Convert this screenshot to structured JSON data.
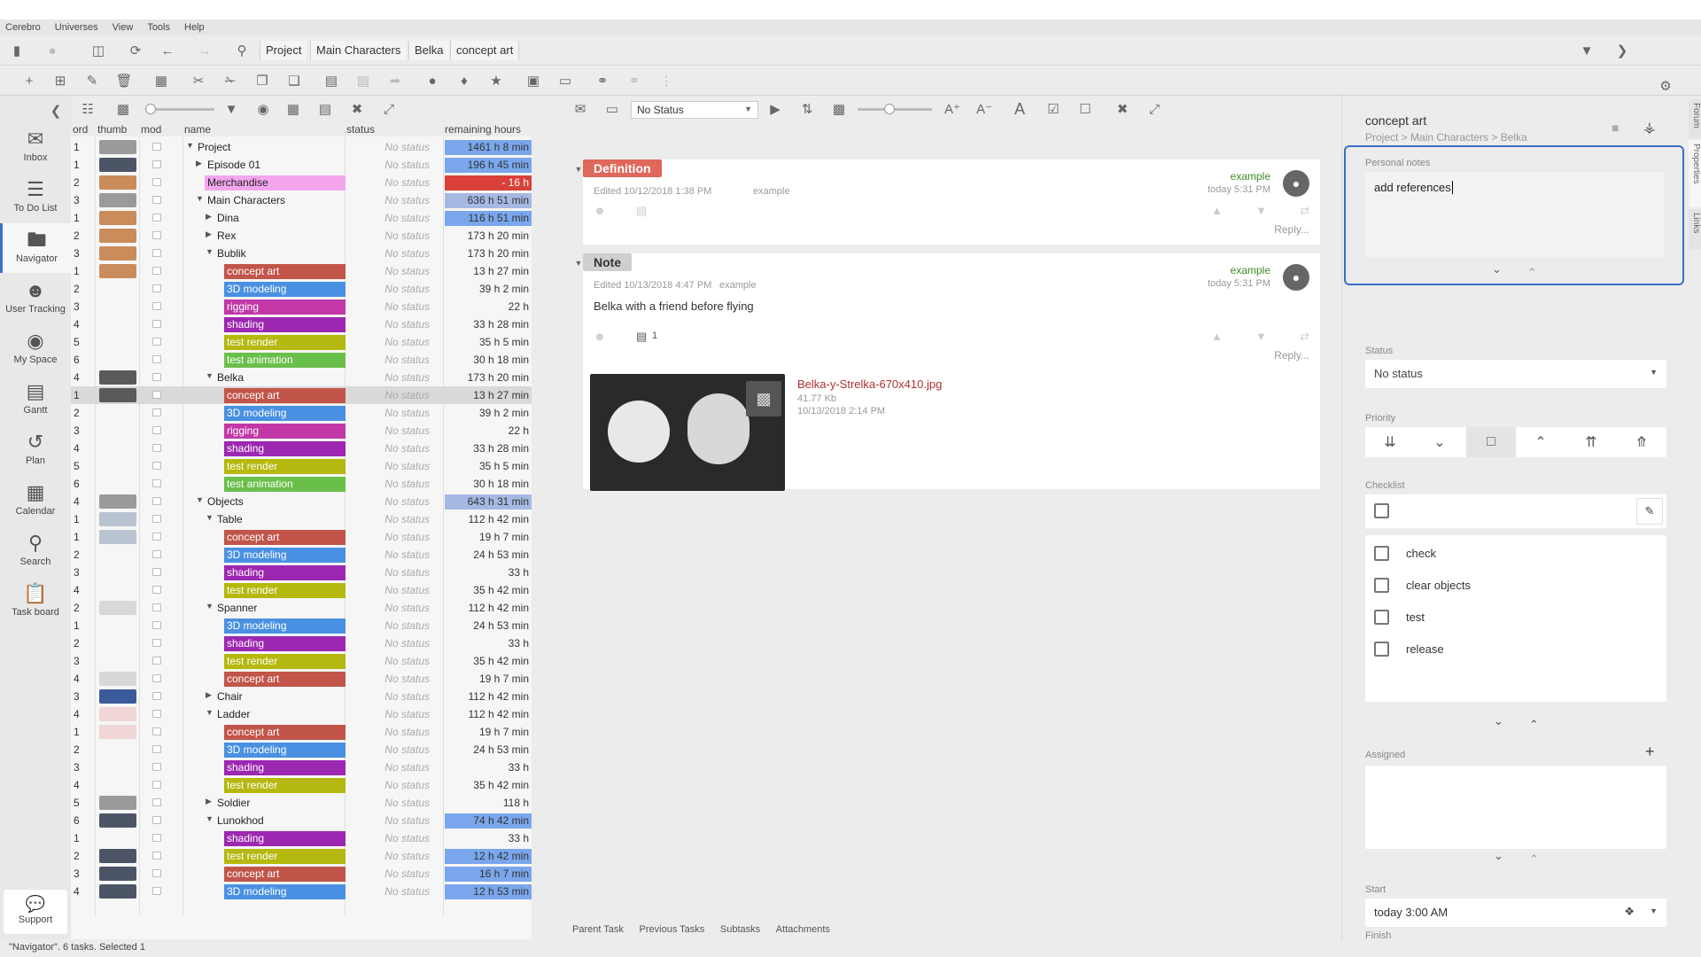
{
  "menu": [
    "Cerebro",
    "Universes",
    "View",
    "Tools",
    "Help"
  ],
  "breadcrumb": [
    "Project",
    "Main Characters",
    "Belka",
    "concept art"
  ],
  "sidebar": [
    {
      "label": "Inbox",
      "icon": "inbox-icon"
    },
    {
      "label": "To Do List",
      "icon": "list-icon"
    },
    {
      "label": "Navigator",
      "icon": "folder-icon"
    },
    {
      "label": "User Tracking",
      "icon": "users-icon"
    },
    {
      "label": "My Space",
      "icon": "globe-icon"
    },
    {
      "label": "Gantt",
      "icon": "gantt-icon"
    },
    {
      "label": "Plan",
      "icon": "plan-icon"
    },
    {
      "label": "Calendar",
      "icon": "calendar-icon"
    },
    {
      "label": "Search",
      "icon": "search-icon"
    },
    {
      "label": "Task board",
      "icon": "clipboard-icon"
    }
  ],
  "support_label": "Support",
  "columns": {
    "ord": "ord",
    "thumb": "thumb",
    "mod": "mod",
    "name": "name",
    "status": "status",
    "remaining": "remaining hours"
  },
  "status_default": "No status",
  "rows": [
    {
      "ord": "1",
      "name": "Project",
      "depth": 0,
      "tw": "open",
      "remaining": "1461 h 8 min",
      "rem_color": "#7aa7ec",
      "thumb": "gray"
    },
    {
      "ord": "1",
      "name": "Episode 01",
      "depth": 1,
      "tw": "closed",
      "remaining": "196 h 45 min",
      "rem_color": "#7aa7ec",
      "thumb": "dark"
    },
    {
      "ord": "2",
      "name": "Merchandise",
      "depth": 1,
      "tw": "none",
      "name_color": "#f3a6ee",
      "remaining": "- 16 h",
      "rem_color": "#d9403a",
      "thumb": "dog"
    },
    {
      "ord": "3",
      "name": "Main Characters",
      "depth": 1,
      "tw": "open",
      "remaining": "636 h 51 min",
      "rem_color": "#a5b9e3",
      "thumb": "gray"
    },
    {
      "ord": "1",
      "name": "Dina",
      "depth": 2,
      "tw": "closed",
      "remaining": "116 h 51 min",
      "rem_color": "#7aa7ec",
      "thumb": "dog"
    },
    {
      "ord": "2",
      "name": "Rex",
      "depth": 2,
      "tw": "closed",
      "remaining": "173 h 20 min",
      "thumb": "dog"
    },
    {
      "ord": "3",
      "name": "Bublik",
      "depth": 2,
      "tw": "open",
      "remaining": "173 h 20 min",
      "thumb": "dog"
    },
    {
      "ord": "1",
      "name": "concept art",
      "depth": 3,
      "tw": "none",
      "name_color": "#c2554a",
      "remaining": "13 h 27 min",
      "thumb": "dog"
    },
    {
      "ord": "2",
      "name": "3D modeling",
      "depth": 3,
      "tw": "none",
      "name_color": "#4a90e2",
      "remaining": "39 h 2 min"
    },
    {
      "ord": "3",
      "name": "rigging",
      "depth": 3,
      "tw": "none",
      "name_color": "#c238a6",
      "remaining": "22 h"
    },
    {
      "ord": "4",
      "name": "shading",
      "depth": 3,
      "tw": "none",
      "name_color": "#9c27b0",
      "remaining": "33 h 28 min"
    },
    {
      "ord": "5",
      "name": "test render",
      "depth": 3,
      "tw": "none",
      "name_color": "#b5b80e",
      "remaining": "35 h 5 min"
    },
    {
      "ord": "6",
      "name": "test animation",
      "depth": 3,
      "tw": "none",
      "name_color": "#6abf4b",
      "remaining": "30 h 18 min"
    },
    {
      "ord": "4",
      "name": "Belka",
      "depth": 2,
      "tw": "open",
      "remaining": "173 h 20 min",
      "thumb": "bw"
    },
    {
      "ord": "1",
      "name": "concept art",
      "depth": 3,
      "tw": "none",
      "name_color": "#c2554a",
      "remaining": "13 h 27 min",
      "thumb": "bw",
      "selected": true
    },
    {
      "ord": "2",
      "name": "3D modeling",
      "depth": 3,
      "tw": "none",
      "name_color": "#4a90e2",
      "remaining": "39 h 2 min"
    },
    {
      "ord": "3",
      "name": "rigging",
      "depth": 3,
      "tw": "none",
      "name_color": "#c238a6",
      "remaining": "22 h"
    },
    {
      "ord": "4",
      "name": "shading",
      "depth": 3,
      "tw": "none",
      "name_color": "#9c27b0",
      "remaining": "33 h 28 min"
    },
    {
      "ord": "5",
      "name": "test render",
      "depth": 3,
      "tw": "none",
      "name_color": "#b5b80e",
      "remaining": "35 h 5 min"
    },
    {
      "ord": "6",
      "name": "test animation",
      "depth": 3,
      "tw": "none",
      "name_color": "#6abf4b",
      "remaining": "30 h 18 min"
    },
    {
      "ord": "4",
      "name": "Objects",
      "depth": 1,
      "tw": "open",
      "remaining": "643 h 31 min",
      "rem_color": "#a5b9e3",
      "thumb": "gray"
    },
    {
      "ord": "1",
      "name": "Table",
      "depth": 2,
      "tw": "open",
      "remaining": "112 h 42 min",
      "thumb": "sketch"
    },
    {
      "ord": "1",
      "name": "concept art",
      "depth": 3,
      "tw": "none",
      "name_color": "#c2554a",
      "remaining": "19 h 7 min",
      "thumb": "sketch"
    },
    {
      "ord": "2",
      "name": "3D modeling",
      "depth": 3,
      "tw": "none",
      "name_color": "#4a90e2",
      "remaining": "24 h 53 min"
    },
    {
      "ord": "3",
      "name": "shading",
      "depth": 3,
      "tw": "none",
      "name_color": "#9c27b0",
      "remaining": "33 h"
    },
    {
      "ord": "4",
      "name": "test render",
      "depth": 3,
      "tw": "none",
      "name_color": "#b5b80e",
      "remaining": "35 h 42 min"
    },
    {
      "ord": "2",
      "name": "Spanner",
      "depth": 2,
      "tw": "open",
      "remaining": "112 h 42 min",
      "thumb": "tool"
    },
    {
      "ord": "1",
      "name": "3D modeling",
      "depth": 3,
      "tw": "none",
      "name_color": "#4a90e2",
      "remaining": "24 h 53 min"
    },
    {
      "ord": "2",
      "name": "shading",
      "depth": 3,
      "tw": "none",
      "name_color": "#9c27b0",
      "remaining": "33 h"
    },
    {
      "ord": "3",
      "name": "test render",
      "depth": 3,
      "tw": "none",
      "name_color": "#b5b80e",
      "remaining": "35 h 42 min"
    },
    {
      "ord": "4",
      "name": "concept art",
      "depth": 3,
      "tw": "none",
      "name_color": "#c2554a",
      "remaining": "19 h 7 min",
      "thumb": "tool"
    },
    {
      "ord": "3",
      "name": "Chair",
      "depth": 2,
      "tw": "closed",
      "remaining": "112 h 42 min",
      "thumb": "blue"
    },
    {
      "ord": "4",
      "name": "Ladder",
      "depth": 2,
      "tw": "open",
      "remaining": "112 h 42 min",
      "thumb": "red"
    },
    {
      "ord": "1",
      "name": "concept art",
      "depth": 3,
      "tw": "none",
      "name_color": "#c2554a",
      "remaining": "19 h 7 min",
      "thumb": "red"
    },
    {
      "ord": "2",
      "name": "3D modeling",
      "depth": 3,
      "tw": "none",
      "name_color": "#4a90e2",
      "remaining": "24 h 53 min"
    },
    {
      "ord": "3",
      "name": "shading",
      "depth": 3,
      "tw": "none",
      "name_color": "#9c27b0",
      "remaining": "33 h"
    },
    {
      "ord": "4",
      "name": "test render",
      "depth": 3,
      "tw": "none",
      "name_color": "#b5b80e",
      "remaining": "35 h 42 min"
    },
    {
      "ord": "5",
      "name": "Soldier",
      "depth": 2,
      "tw": "closed",
      "remaining": "118 h",
      "thumb": "gray"
    },
    {
      "ord": "6",
      "name": "Lunokhod",
      "depth": 2,
      "tw": "open",
      "remaining": "74 h 42 min",
      "rem_color": "#7aa7ec",
      "thumb": "dark"
    },
    {
      "ord": "1",
      "name": "shading",
      "depth": 3,
      "tw": "none",
      "name_color": "#9c27b0",
      "remaining": "33 h"
    },
    {
      "ord": "2",
      "name": "test render",
      "depth": 3,
      "tw": "none",
      "name_color": "#b5b80e",
      "remaining": "12 h 42 min",
      "rem_color": "#7aa7ec",
      "thumb": "dark"
    },
    {
      "ord": "3",
      "name": "concept art",
      "depth": 3,
      "tw": "none",
      "name_color": "#c2554a",
      "remaining": "16 h 7 min",
      "rem_color": "#7aa7ec",
      "thumb": "dark"
    },
    {
      "ord": "4",
      "name": "3D modeling",
      "depth": 3,
      "tw": "none",
      "name_color": "#4a90e2",
      "remaining": "12 h 53 min",
      "rem_color": "#7aa7ec",
      "thumb": "dark"
    }
  ],
  "center": {
    "status_select": "No Status",
    "definition": {
      "tag": "Definition",
      "edited": "Edited 10/12/2018 1:38 PM",
      "author_small": "example",
      "author": "example",
      "time": "today 5:31 PM",
      "reply": "Reply..."
    },
    "note": {
      "tag": "Note",
      "edited": "Edited 10/13/2018 4:47 PM",
      "author_small": "example",
      "author": "example",
      "time": "today 5:31 PM",
      "body": "Belka with a friend before flying",
      "attach_count": "1",
      "reply": "Reply...",
      "file_name": "Belka-y-Strelka-670x410.jpg",
      "file_size": "41.77 Kb",
      "file_date": "10/13/2018 2:14 PM"
    },
    "bottom_tabs": [
      "Parent Task",
      "Previous Tasks",
      "Subtasks",
      "Attachments"
    ]
  },
  "props": {
    "title": "concept art",
    "path": "Project > Main Characters > Belka",
    "notes_label": "Personal notes",
    "notes_value": "add references",
    "status_label": "Status",
    "status_value": "No status",
    "priority_label": "Priority",
    "checklist_label": "Checklist",
    "checklist": [
      "check",
      "clear objects",
      "test",
      "release"
    ],
    "assigned_label": "Assigned",
    "start_label": "Start",
    "start_value": "today 3:00 AM",
    "finish_label": "Finish"
  },
  "vtabs": [
    "Forum",
    "Properties",
    "Links"
  ],
  "statusbar": "\"Navigator\". 6 tasks. Selected 1",
  "accent": "#3a6fc9"
}
